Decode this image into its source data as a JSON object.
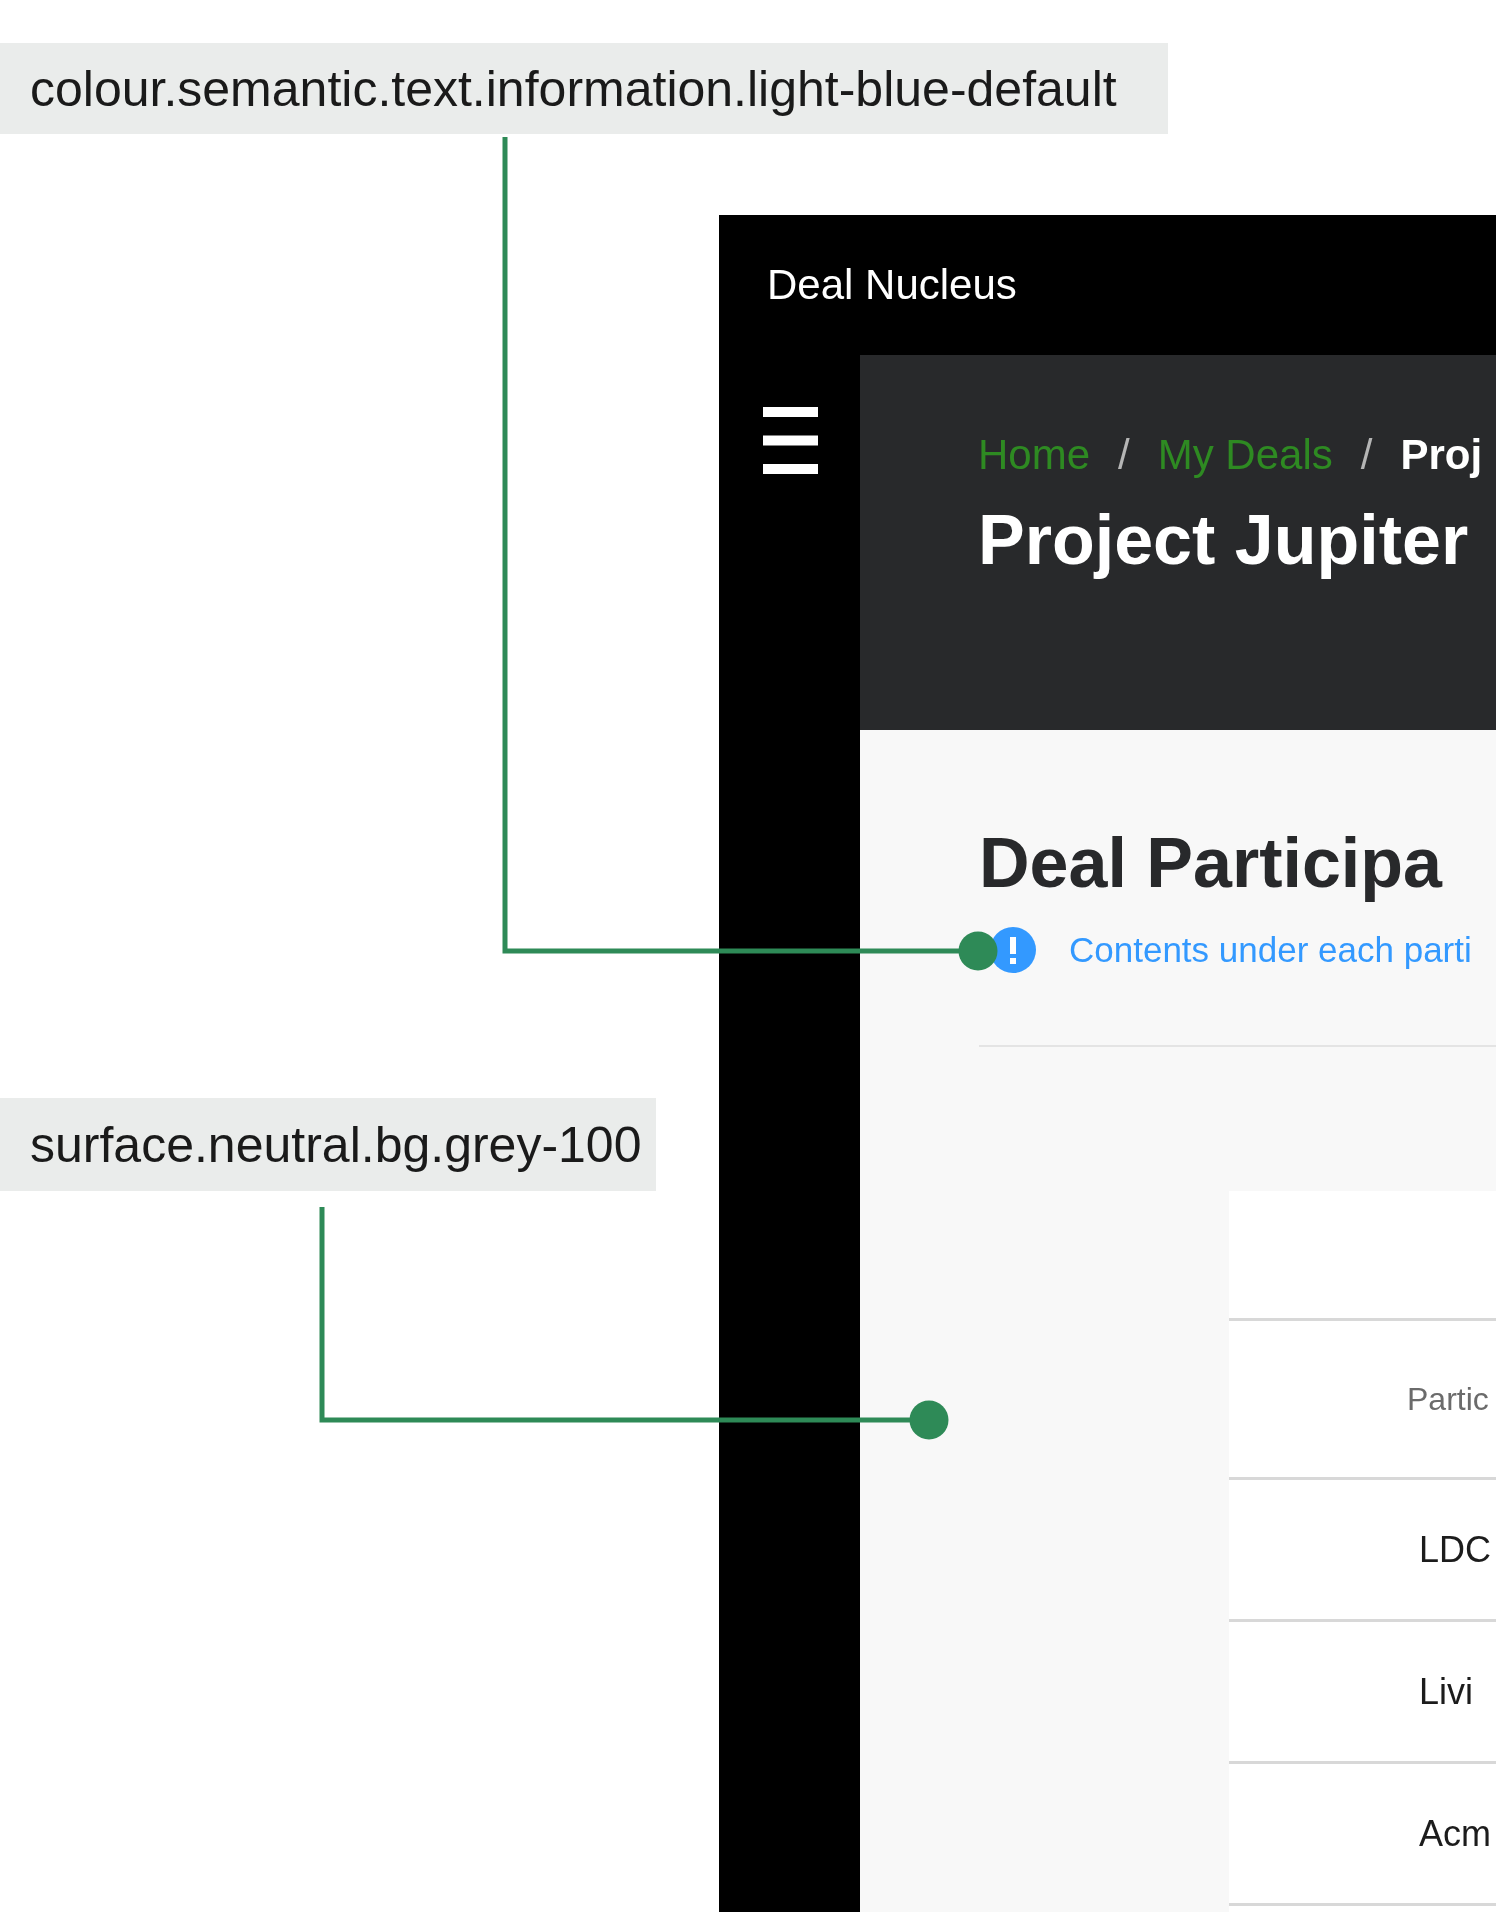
{
  "annotations": [
    {
      "label": "colour.semantic.text.information.light-blue-default"
    },
    {
      "label": "surface.neutral.bg.grey-100"
    }
  ],
  "app": {
    "title": "Deal Nucleus",
    "breadcrumbs": [
      {
        "kind": "link",
        "label": "Home"
      },
      {
        "kind": "separator",
        "label": "/"
      },
      {
        "kind": "link",
        "label": "My Deals"
      },
      {
        "kind": "separator",
        "label": "/"
      },
      {
        "kind": "current",
        "label": "Proj"
      }
    ],
    "page_title": "Project Jupiter",
    "section_title": "Deal Participa",
    "info_message": "Contents under each parti",
    "table": {
      "columns": [
        "Partic"
      ],
      "rows": [
        [
          "LDC"
        ],
        [
          "Livi"
        ],
        [
          "Acm"
        ]
      ]
    }
  }
}
